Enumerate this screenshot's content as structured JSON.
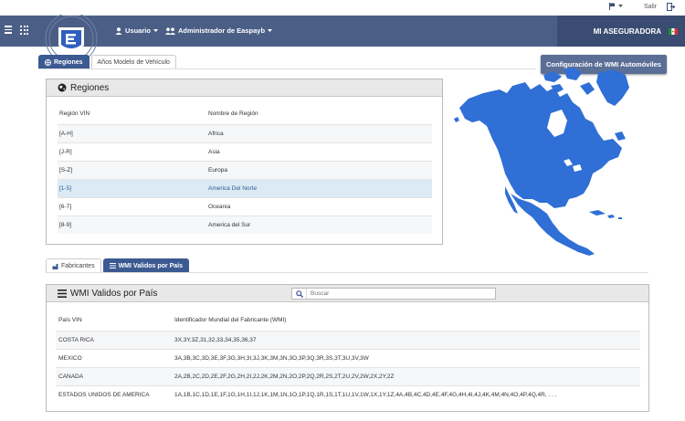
{
  "topbar": {
    "salir_label": "Salir"
  },
  "nav": {
    "usuario_label": "Usuario",
    "admin_label": "Administrador de Easpayb",
    "brand_label": "MI ASEGURADORA"
  },
  "tabs_top": [
    {
      "label": "Regiones",
      "active": true
    },
    {
      "label": "Años Modelo de Vehículo",
      "active": false
    }
  ],
  "config_button": "Configuración de WMI Automóviles",
  "regiones_panel": {
    "title": "Regiones",
    "headers": [
      "Región VIN",
      "Nombre de Región"
    ],
    "rows": [
      [
        "[A-H]",
        "Africa"
      ],
      [
        "[J-R]",
        "Asia"
      ],
      [
        "[S-Z]",
        "Europa"
      ],
      [
        "[1-5]",
        "America Del Norte"
      ],
      [
        "[6-7]",
        "Oceania"
      ],
      [
        "[8-9]",
        "America del Sur"
      ]
    ]
  },
  "tabs_bottom": [
    {
      "label": "Fabricantes",
      "active": false
    },
    {
      "label": "WMI Validos por País",
      "active": true
    }
  ],
  "wmi_panel": {
    "title": "WMI Validos por País",
    "search_placeholder": "Buscar",
    "headers": [
      "País VIN",
      "Identificador Mundial del Fabricante (WMI)"
    ],
    "rows": [
      [
        "COSTA RICA",
        "3X,3Y,3Z,31,32,33,34,35,36,37"
      ],
      [
        "MEXICO",
        "3A,3B,3C,3D,3E,3F,3G,3H,3I,3J,3K,3M,3N,3O,3P,3Q,3R,3S,3T,3U,3V,3W"
      ],
      [
        "CANADA",
        "2A,2B,2C,2D,2E,2F,2G,2H,2I,2J,2K,2M,2N,2O,2P,2Q,2R,2S,2T,2U,2V,2W,2X,2Y,2Z"
      ],
      [
        "ESTADOS UNIDOS DE AMERICA",
        "1A,1B,1C,1D,1E,1F,1G,1H,1I,1J,1K,1M,1N,1O,1P,1Q,1R,1S,1T,1U,1V,1W,1X,1Y,1Z,4A,4B,4C,4D,4E,4F,4G,4H,4I,4J,4K,4M,4N,4O,4P,4Q,4R, . . ."
      ]
    ]
  },
  "colors": {
    "navbar": "#4b5f86",
    "brand_bg": "#3a4c71",
    "active_tab": "#3c5a92",
    "map_fill": "#2f6fd6",
    "selected_row": "#dceaf5"
  }
}
